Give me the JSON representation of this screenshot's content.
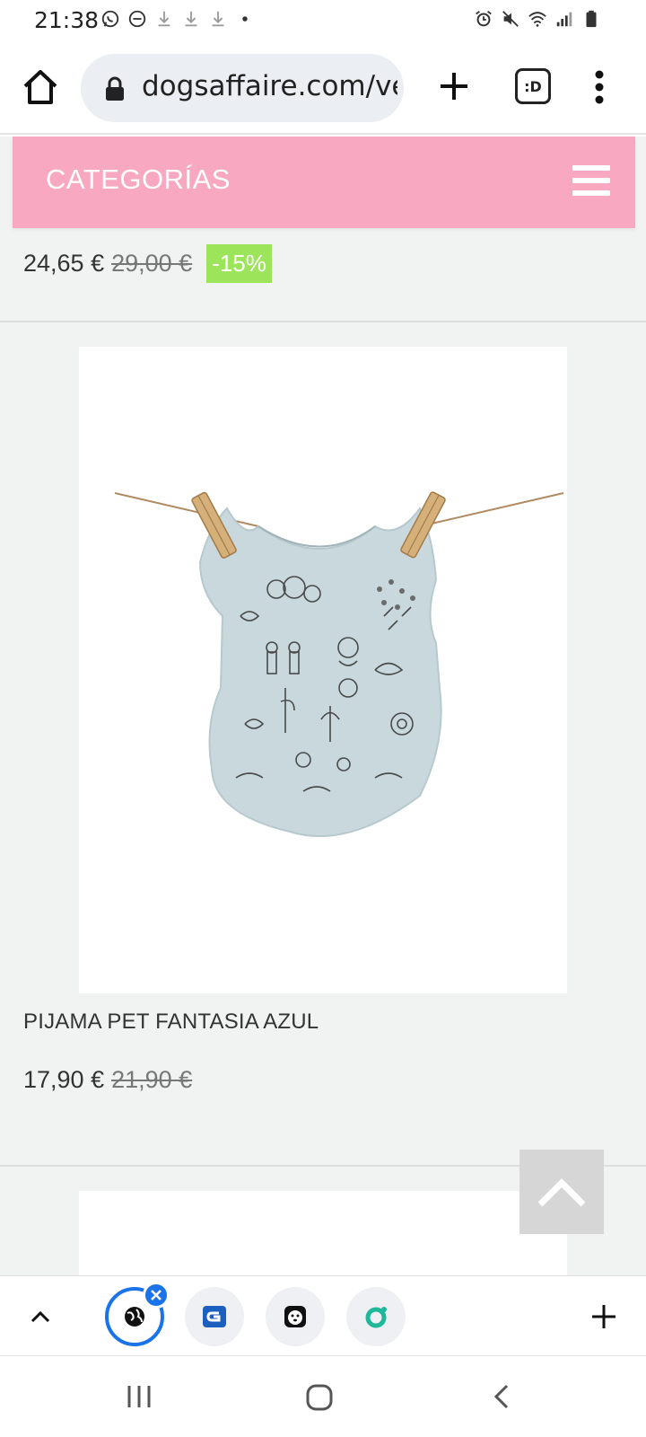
{
  "status_bar": {
    "time": "21:38",
    "left_icons": [
      "whatsapp-icon",
      "dnd-icon",
      "download-icon",
      "download-icon",
      "download-icon",
      "dot-icon"
    ],
    "right_icons": [
      "alarm-icon",
      "mute-icon",
      "wifi-icon",
      "signal-icon",
      "battery-icon"
    ]
  },
  "browser": {
    "url": "dogsaffaire.com/ve",
    "tabs_label": ":D"
  },
  "page": {
    "categories_label": "CATEGORÍAS",
    "prev_product": {
      "price": "24,65 €",
      "old_price": "29,00 €",
      "discount": "-15%"
    },
    "product": {
      "name": "PIJAMA PET FANTASIA AZUL",
      "price": "17,90 €",
      "old_price": "21,90 €"
    }
  },
  "colors": {
    "category_bar": "#f8a9c1",
    "discount_badge": "#9ce55a",
    "page_bg": "#f1f2f2",
    "active_tab_ring": "#1a73e8",
    "shirt": "#c8d8dc"
  },
  "tab_strip": {
    "tabs": [
      "globe-tab-icon",
      "g-app-tab-icon",
      "dog-tab-icon",
      "green-app-tab-icon"
    ]
  }
}
